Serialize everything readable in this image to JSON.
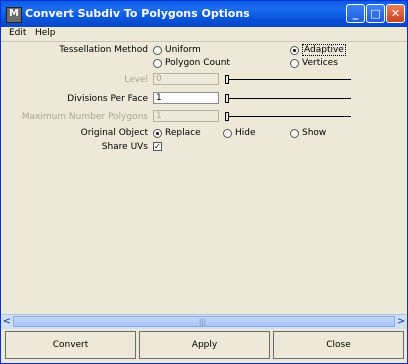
{
  "window": {
    "title": "Convert Subdiv To Polygons Options",
    "minimize_label": "_",
    "maximize_label": "□",
    "close_label": "✕"
  },
  "menu": {
    "items": [
      "Edit",
      "Help"
    ]
  },
  "options": {
    "tessellation": {
      "label": "Tessellation Method",
      "choices": [
        "Uniform",
        "Adaptive",
        "Polygon Count",
        "Vertices"
      ],
      "selected": "Adaptive"
    },
    "level": {
      "label": "Level",
      "value": "0",
      "enabled": false
    },
    "divisions": {
      "label": "Divisions Per Face",
      "value": "1",
      "enabled": true
    },
    "max_polygons": {
      "label": "Maximum Number Polygons",
      "value": "1",
      "enabled": false
    },
    "original_object": {
      "label": "Original Object",
      "choices": [
        "Replace",
        "Hide",
        "Show"
      ],
      "selected": "Replace"
    },
    "share_uvs": {
      "label": "Share UVs",
      "checked": true,
      "mark": "✓"
    }
  },
  "scroll": {
    "left_arrow": "<",
    "right_arrow": ">",
    "grip": "|||"
  },
  "buttons": {
    "convert": "Convert",
    "apply": "Apply",
    "close": "Close"
  }
}
